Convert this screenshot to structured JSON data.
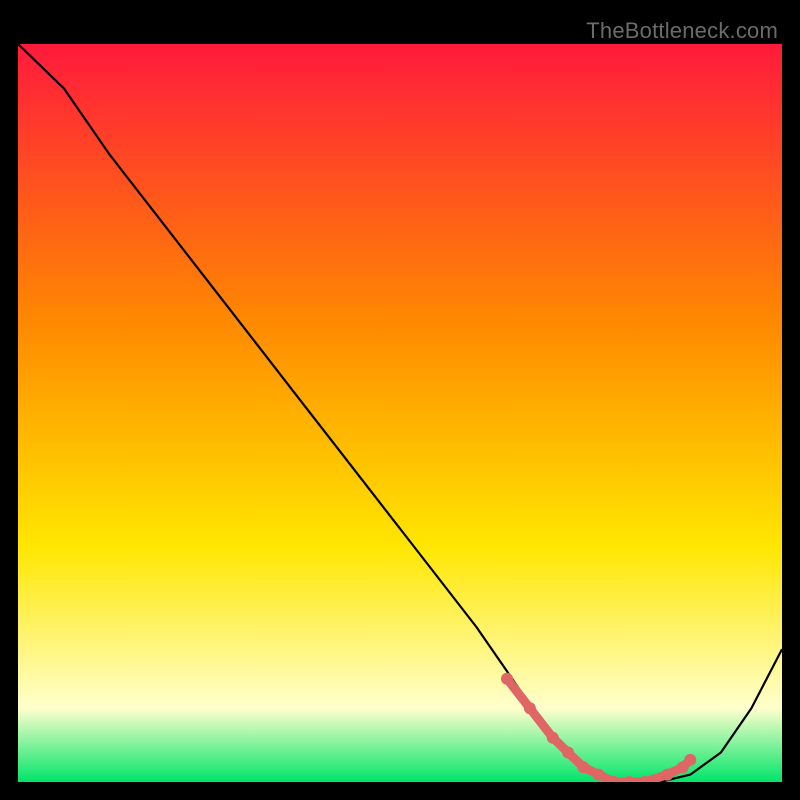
{
  "watermark": "TheBottleneck.com",
  "colors": {
    "gradient_top": "#ff1a3c",
    "gradient_mid1": "#ff8a00",
    "gradient_mid2": "#ffe600",
    "gradient_pale": "#ffffcc",
    "gradient_bottom": "#00e56a",
    "curve": "#000000",
    "marker": "#e06666",
    "background": "#000000"
  },
  "chart_data": {
    "type": "line",
    "title": "",
    "xlabel": "",
    "ylabel": "",
    "xlim": [
      0,
      100
    ],
    "ylim": [
      0,
      100
    ],
    "grid": false,
    "series": [
      {
        "name": "bottleneck-curve",
        "x": [
          0,
          6,
          12,
          18,
          24,
          30,
          36,
          42,
          48,
          54,
          60,
          64,
          68,
          72,
          76,
          80,
          84,
          88,
          92,
          96,
          100
        ],
        "y": [
          100,
          94,
          85,
          77,
          69,
          61,
          53,
          45,
          37,
          29,
          21,
          15,
          9,
          4,
          1,
          0,
          0,
          1,
          4,
          10,
          18
        ]
      }
    ],
    "markers": {
      "name": "highlighted-points",
      "x": [
        64,
        67,
        70,
        72,
        74,
        76,
        78,
        80,
        82,
        85,
        87,
        88
      ],
      "y": [
        14,
        10,
        6,
        4,
        2,
        1,
        0,
        0,
        0,
        1,
        2,
        3
      ]
    }
  }
}
